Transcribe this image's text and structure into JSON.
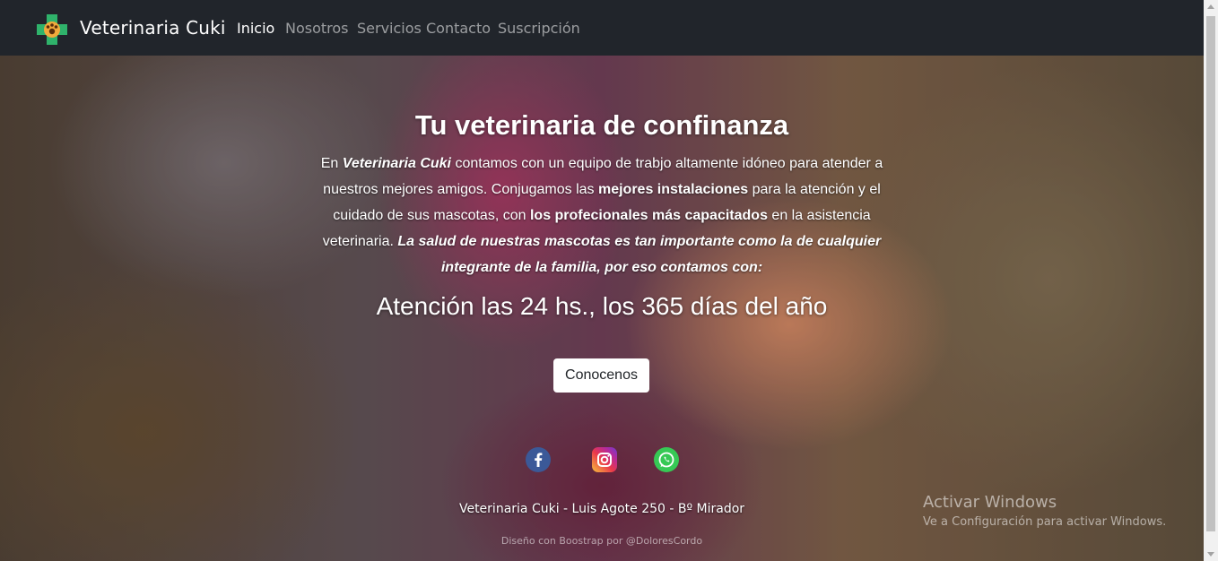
{
  "navbar": {
    "brand": "Veterinaria Cuki",
    "links": [
      "Inicio",
      "Nosotros",
      "Servicios",
      "Contacto",
      "Suscripción"
    ]
  },
  "hero": {
    "title": "Tu veterinaria de confinanza",
    "intro": {
      "p1": "En ",
      "brand": "Veterinaria Cuki",
      "p2": " contamos con un equipo de trabjo altamente idóneo para atender a nuestros mejores amigos. Conjugamos las ",
      "b1": "mejores instalaciones",
      "p3": " para la atención y el cuidado de sus mascotas, con ",
      "b2": "los profecionales más capacitados",
      "p4": " en la asistencia veterinaria. ",
      "emph": "La salud de nuestras mascotas es tan importante como la de cualquier integrante de la familia, por eso contamos con:"
    },
    "hours": "Atención las 24 hs., los 365 días del año",
    "button": "Conocenos"
  },
  "social": [
    "facebook-icon",
    "instagram-icon",
    "whatsapp-icon"
  ],
  "footer": {
    "address": "Veterinaria Cuki - Luis Agote 250 - Bº Mirador",
    "credits": "Diseño con Boostrap por @DoloresCordo"
  },
  "watermark": {
    "line1": "Activar Windows",
    "line2": "Ve a Configuración para activar Windows."
  },
  "colors": {
    "navbar": "#21252b",
    "button_bg": "#ffffff",
    "facebook": "#3b5998",
    "whatsapp": "#36c955"
  }
}
